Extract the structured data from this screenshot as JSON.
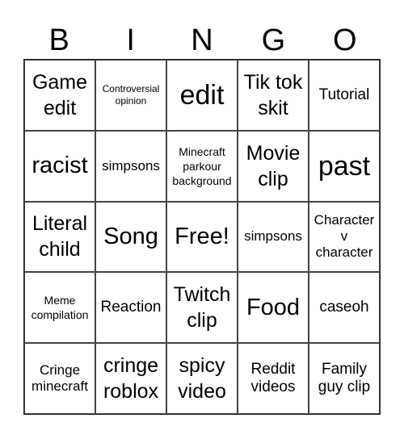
{
  "header": {
    "letters": [
      "B",
      "I",
      "N",
      "G",
      "O"
    ]
  },
  "cells": [
    {
      "text": "Game edit",
      "size": "s-lg"
    },
    {
      "text": "Controversial opinion",
      "size": "s-xs"
    },
    {
      "text": "edit",
      "size": "s-xxl"
    },
    {
      "text": "Tik tok skit",
      "size": "s-lg"
    },
    {
      "text": "Tutorial",
      "size": "s-md2"
    },
    {
      "text": "racist",
      "size": "s-xl"
    },
    {
      "text": "simpsons",
      "size": "s-md"
    },
    {
      "text": "Minecraft parkour background",
      "size": "s-sm"
    },
    {
      "text": "Movie clip",
      "size": "s-lg"
    },
    {
      "text": "past",
      "size": "s-xxl"
    },
    {
      "text": "Literal child",
      "size": "s-lg"
    },
    {
      "text": "Song",
      "size": "s-xl"
    },
    {
      "text": "Free!",
      "size": "s-xl"
    },
    {
      "text": "simpsons",
      "size": "s-md"
    },
    {
      "text": "Character v character",
      "size": "s-md"
    },
    {
      "text": "Meme compilation",
      "size": "s-sm"
    },
    {
      "text": "Reaction",
      "size": "s-md2"
    },
    {
      "text": "Twitch clip",
      "size": "s-lg"
    },
    {
      "text": "Food",
      "size": "s-xl"
    },
    {
      "text": "caseoh",
      "size": "s-md2"
    },
    {
      "text": "Cringe minecraft",
      "size": "s-md"
    },
    {
      "text": "cringe roblox",
      "size": "s-lg"
    },
    {
      "text": "spicy video",
      "size": "s-lg"
    },
    {
      "text": "Reddit videos",
      "size": "s-md2"
    },
    {
      "text": "Family guy clip",
      "size": "s-md2"
    }
  ]
}
